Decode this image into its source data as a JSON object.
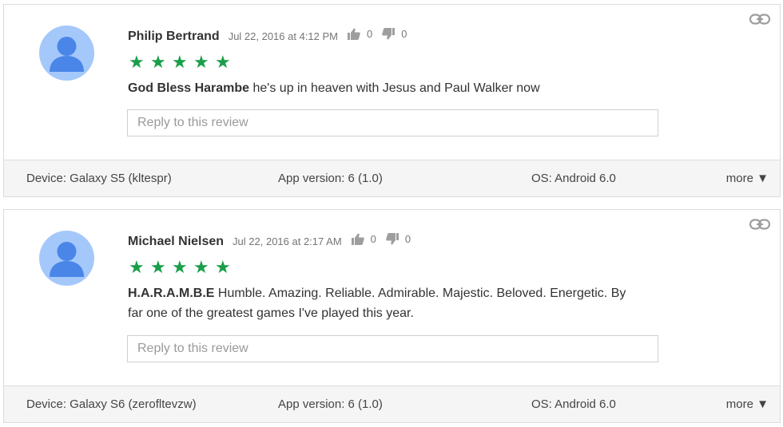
{
  "reviews": [
    {
      "author": "Philip Bertrand",
      "date": "Jul 22, 2016 at 4:12 PM",
      "rating": 5,
      "stars": [
        "★",
        "★",
        "★",
        "★",
        "★"
      ],
      "thumbs_up_count": "0",
      "thumbs_down_count": "0",
      "headline": "God Bless Harambe",
      "body": " he's up in heaven with Jesus and Paul Walker now",
      "reply_placeholder": "Reply to this review",
      "device": "Device: Galaxy S5 (kltespr)",
      "app_version": "App version: 6 (1.0)",
      "os": "OS: Android 6.0",
      "more_label": "more ▼"
    },
    {
      "author": "Michael Nielsen",
      "date": "Jul 22, 2016 at 2:17 AM",
      "rating": 5,
      "stars": [
        "★",
        "★",
        "★",
        "★",
        "★"
      ],
      "thumbs_up_count": "0",
      "thumbs_down_count": "0",
      "headline": "H.A.R.A.M.B.E",
      "body": " Humble. Amazing. Reliable. Admirable. Majestic. Beloved. Energetic. By far one of the greatest games I've played this year.",
      "reply_placeholder": "Reply to this review",
      "device": "Device: Galaxy S6 (zerofltevzw)",
      "app_version": "App version: 6 (1.0)",
      "os": "OS: Android 6.0",
      "more_label": "more ▼"
    }
  ],
  "colors": {
    "star": "#1a9e4a",
    "avatar_bg": "#a5c8fb",
    "avatar_fg": "#4a86e8",
    "footer_bg": "#f5f5f5",
    "border": "#dcdcdc"
  },
  "icons": {
    "avatar": "person-avatar-icon",
    "link": "link-icon",
    "thumbs_up": "thumbs-up-icon",
    "thumbs_down": "thumbs-down-icon"
  }
}
